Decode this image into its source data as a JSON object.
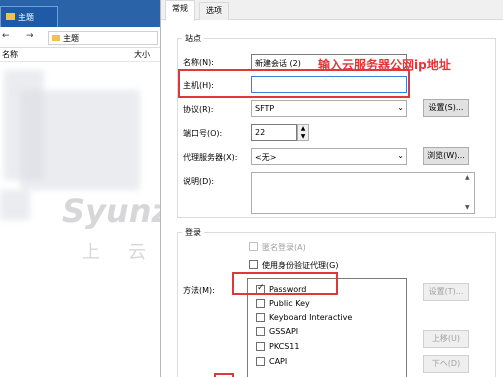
{
  "explorer": {
    "tab_label": "主题",
    "address": "主题",
    "col_name": "名称",
    "col_size": "大小",
    "nav_back": "←",
    "nav_forward": "→"
  },
  "watermark": {
    "line1": "Syunz.com",
    "line2": "上云教程"
  },
  "dialog": {
    "tabs": [
      "常规",
      "选项"
    ],
    "site": {
      "legend": "站点",
      "name_label": "名称(N):",
      "name_value": "新建会话 (2)",
      "host_label": "主机(H):",
      "host_value": "",
      "protocol_label": "协议(R):",
      "protocol_value": "SFTP",
      "settings_button": "设置(S)...",
      "port_label": "端口号(O):",
      "port_value": "22",
      "proxy_label": "代理服务器(X):",
      "proxy_value": "<无>",
      "browse_button": "浏览(W)...",
      "desc_label": "说明(D):"
    },
    "login": {
      "legend": "登录",
      "anonymous_label": "匿名登录(A)",
      "agent_label": "使用身份验证代理(G)",
      "method_label": "方法(M):",
      "methods": [
        {
          "label": "Password",
          "checked": true
        },
        {
          "label": "Public Key",
          "checked": false
        },
        {
          "label": "Keyboard Interactive",
          "checked": false
        },
        {
          "label": "GSSAPI",
          "checked": false
        },
        {
          "label": "PKCS11",
          "checked": false
        },
        {
          "label": "CAPI",
          "checked": false
        }
      ],
      "settings_button": "设置(T)...",
      "up_button": "上移(U)",
      "down_button": "下ヘ(D)"
    }
  },
  "annotation": {
    "text": "输入云服务器公网ip地址",
    "color": "#e0373a"
  }
}
